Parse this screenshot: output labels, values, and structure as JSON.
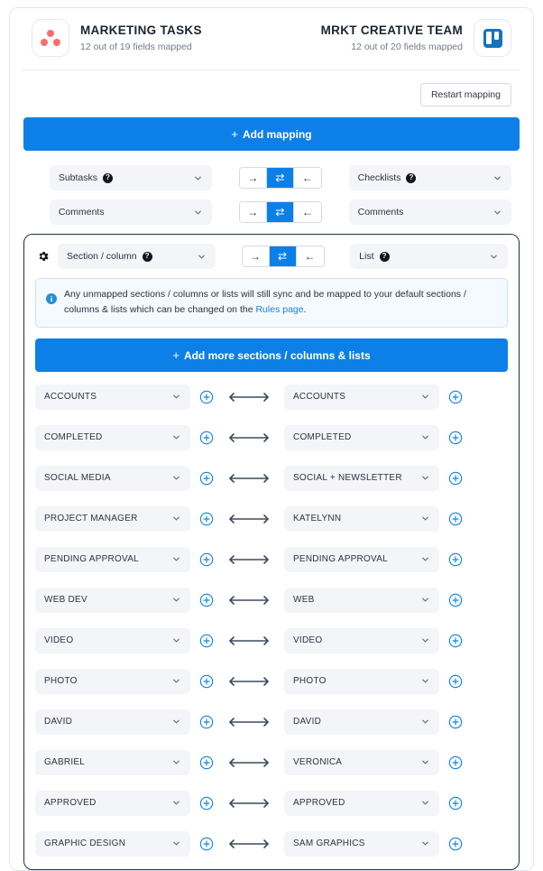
{
  "header": {
    "left": {
      "icon": "asana-logo-icon",
      "title": "MARKETING TASKS",
      "subtitle": "12 out of 19 fields mapped"
    },
    "right": {
      "icon": "trello-logo-icon",
      "title": "MRKT CREATIVE TEAM",
      "subtitle": "12 out of 20 fields mapped"
    }
  },
  "toolbar": {
    "restart_label": "Restart mapping"
  },
  "add_mapping": {
    "plus": "+",
    "label": "Add mapping"
  },
  "direction": {
    "right_glyph": "→",
    "both_glyph": "⇄",
    "left_glyph": "←",
    "active": "both"
  },
  "top_mappings": [
    {
      "left_label": "Subtasks",
      "left_help": "?",
      "right_label": "Checklists",
      "right_help": "?",
      "direction": "both"
    },
    {
      "left_label": "Comments",
      "left_help": "",
      "right_label": "Comments",
      "right_help": "",
      "direction": "both"
    }
  ],
  "section_block": {
    "gear_icon": "gear-icon",
    "left_label": "Section / column",
    "left_help": "?",
    "right_label": "List",
    "right_help": "?",
    "direction": "both",
    "info": {
      "icon": "info-icon",
      "text_before": "Any unmapped sections / columns or lists will still sync and be mapped to your default sections / columns & lists which can be changed on the ",
      "link_text": "Rules page",
      "text_after": "."
    },
    "add_more": {
      "plus": "+",
      "label": "Add more sections / columns & lists"
    },
    "rows": [
      {
        "left": "ACCOUNTS",
        "right": "ACCOUNTS"
      },
      {
        "left": "COMPLETED",
        "right": "COMPLETED"
      },
      {
        "left": "SOCIAL MEDIA",
        "right": "SOCIAL + NEWSLETTER"
      },
      {
        "left": "PROJECT MANAGER",
        "right": "KATELYNN"
      },
      {
        "left": "PENDING APPROVAL",
        "right": "PENDING APPROVAL"
      },
      {
        "left": "WEB DEV",
        "right": "WEB"
      },
      {
        "left": "VIDEO",
        "right": "VIDEO"
      },
      {
        "left": "PHOTO",
        "right": "PHOTO"
      },
      {
        "left": "DAVID",
        "right": "DAVID"
      },
      {
        "left": "GABRIEL",
        "right": "VERONICA"
      },
      {
        "left": "APPROVED",
        "right": "APPROVED"
      },
      {
        "left": "GRAPHIC DESIGN",
        "right": "SAM GRAPHICS"
      }
    ]
  },
  "colors": {
    "accent_blue": "#0d80e8",
    "link_blue": "#1383d8",
    "asana_coral": "#fc6d6d",
    "trello_blue": "#1573bd",
    "border_navy": "#1d2f4e",
    "pill_bg": "#f3f5f8"
  }
}
